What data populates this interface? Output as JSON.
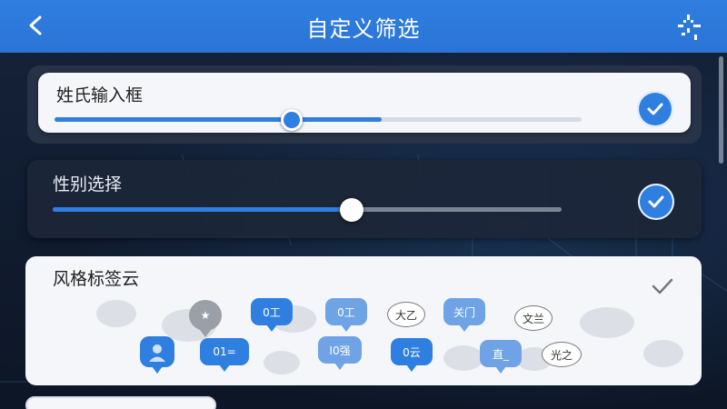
{
  "header": {
    "title": "自定义筛选",
    "back_icon": "chevron-left-icon",
    "more_icon": "sparkle-menu-icon"
  },
  "filters": [
    {
      "label": "姓氏输入框",
      "slider_fraction": 0.41,
      "checked": true
    },
    {
      "label": "性别选择",
      "slider_fraction": 0.59,
      "checked": true
    }
  ],
  "tag_cloud": {
    "label": "风格标签云",
    "checked": true,
    "tags": [
      {
        "text": "★",
        "style": "gray"
      },
      {
        "text": "0工",
        "style": "blue"
      },
      {
        "text": "0工",
        "style": "lightblue"
      },
      {
        "text": "大乙",
        "style": "outline"
      },
      {
        "text": "关门",
        "style": "lightblue"
      },
      {
        "text": "文兰",
        "style": "outline"
      },
      {
        "text": "01=",
        "style": "blue"
      },
      {
        "text": "I0强",
        "style": "lightblue"
      },
      {
        "text": "0云",
        "style": "blue"
      },
      {
        "text": "直_",
        "style": "lightblue"
      },
      {
        "text": "光之",
        "style": "outline"
      }
    ]
  },
  "colors": {
    "accent": "#2f7fe0",
    "track_inactive": "#d6dbe3",
    "track_inactive_dark": "#7c8594"
  }
}
